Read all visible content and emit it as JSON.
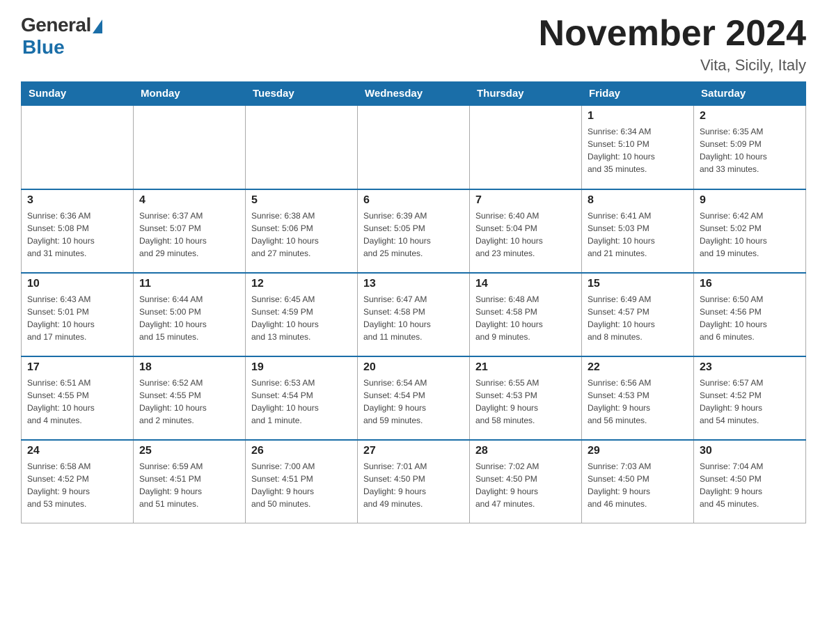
{
  "logo": {
    "general": "General",
    "blue": "Blue"
  },
  "title": "November 2024",
  "location": "Vita, Sicily, Italy",
  "weekdays": [
    "Sunday",
    "Monday",
    "Tuesday",
    "Wednesday",
    "Thursday",
    "Friday",
    "Saturday"
  ],
  "weeks": [
    [
      {
        "day": "",
        "info": ""
      },
      {
        "day": "",
        "info": ""
      },
      {
        "day": "",
        "info": ""
      },
      {
        "day": "",
        "info": ""
      },
      {
        "day": "",
        "info": ""
      },
      {
        "day": "1",
        "info": "Sunrise: 6:34 AM\nSunset: 5:10 PM\nDaylight: 10 hours\nand 35 minutes."
      },
      {
        "day": "2",
        "info": "Sunrise: 6:35 AM\nSunset: 5:09 PM\nDaylight: 10 hours\nand 33 minutes."
      }
    ],
    [
      {
        "day": "3",
        "info": "Sunrise: 6:36 AM\nSunset: 5:08 PM\nDaylight: 10 hours\nand 31 minutes."
      },
      {
        "day": "4",
        "info": "Sunrise: 6:37 AM\nSunset: 5:07 PM\nDaylight: 10 hours\nand 29 minutes."
      },
      {
        "day": "5",
        "info": "Sunrise: 6:38 AM\nSunset: 5:06 PM\nDaylight: 10 hours\nand 27 minutes."
      },
      {
        "day": "6",
        "info": "Sunrise: 6:39 AM\nSunset: 5:05 PM\nDaylight: 10 hours\nand 25 minutes."
      },
      {
        "day": "7",
        "info": "Sunrise: 6:40 AM\nSunset: 5:04 PM\nDaylight: 10 hours\nand 23 minutes."
      },
      {
        "day": "8",
        "info": "Sunrise: 6:41 AM\nSunset: 5:03 PM\nDaylight: 10 hours\nand 21 minutes."
      },
      {
        "day": "9",
        "info": "Sunrise: 6:42 AM\nSunset: 5:02 PM\nDaylight: 10 hours\nand 19 minutes."
      }
    ],
    [
      {
        "day": "10",
        "info": "Sunrise: 6:43 AM\nSunset: 5:01 PM\nDaylight: 10 hours\nand 17 minutes."
      },
      {
        "day": "11",
        "info": "Sunrise: 6:44 AM\nSunset: 5:00 PM\nDaylight: 10 hours\nand 15 minutes."
      },
      {
        "day": "12",
        "info": "Sunrise: 6:45 AM\nSunset: 4:59 PM\nDaylight: 10 hours\nand 13 minutes."
      },
      {
        "day": "13",
        "info": "Sunrise: 6:47 AM\nSunset: 4:58 PM\nDaylight: 10 hours\nand 11 minutes."
      },
      {
        "day": "14",
        "info": "Sunrise: 6:48 AM\nSunset: 4:58 PM\nDaylight: 10 hours\nand 9 minutes."
      },
      {
        "day": "15",
        "info": "Sunrise: 6:49 AM\nSunset: 4:57 PM\nDaylight: 10 hours\nand 8 minutes."
      },
      {
        "day": "16",
        "info": "Sunrise: 6:50 AM\nSunset: 4:56 PM\nDaylight: 10 hours\nand 6 minutes."
      }
    ],
    [
      {
        "day": "17",
        "info": "Sunrise: 6:51 AM\nSunset: 4:55 PM\nDaylight: 10 hours\nand 4 minutes."
      },
      {
        "day": "18",
        "info": "Sunrise: 6:52 AM\nSunset: 4:55 PM\nDaylight: 10 hours\nand 2 minutes."
      },
      {
        "day": "19",
        "info": "Sunrise: 6:53 AM\nSunset: 4:54 PM\nDaylight: 10 hours\nand 1 minute."
      },
      {
        "day": "20",
        "info": "Sunrise: 6:54 AM\nSunset: 4:54 PM\nDaylight: 9 hours\nand 59 minutes."
      },
      {
        "day": "21",
        "info": "Sunrise: 6:55 AM\nSunset: 4:53 PM\nDaylight: 9 hours\nand 58 minutes."
      },
      {
        "day": "22",
        "info": "Sunrise: 6:56 AM\nSunset: 4:53 PM\nDaylight: 9 hours\nand 56 minutes."
      },
      {
        "day": "23",
        "info": "Sunrise: 6:57 AM\nSunset: 4:52 PM\nDaylight: 9 hours\nand 54 minutes."
      }
    ],
    [
      {
        "day": "24",
        "info": "Sunrise: 6:58 AM\nSunset: 4:52 PM\nDaylight: 9 hours\nand 53 minutes."
      },
      {
        "day": "25",
        "info": "Sunrise: 6:59 AM\nSunset: 4:51 PM\nDaylight: 9 hours\nand 51 minutes."
      },
      {
        "day": "26",
        "info": "Sunrise: 7:00 AM\nSunset: 4:51 PM\nDaylight: 9 hours\nand 50 minutes."
      },
      {
        "day": "27",
        "info": "Sunrise: 7:01 AM\nSunset: 4:50 PM\nDaylight: 9 hours\nand 49 minutes."
      },
      {
        "day": "28",
        "info": "Sunrise: 7:02 AM\nSunset: 4:50 PM\nDaylight: 9 hours\nand 47 minutes."
      },
      {
        "day": "29",
        "info": "Sunrise: 7:03 AM\nSunset: 4:50 PM\nDaylight: 9 hours\nand 46 minutes."
      },
      {
        "day": "30",
        "info": "Sunrise: 7:04 AM\nSunset: 4:50 PM\nDaylight: 9 hours\nand 45 minutes."
      }
    ]
  ]
}
